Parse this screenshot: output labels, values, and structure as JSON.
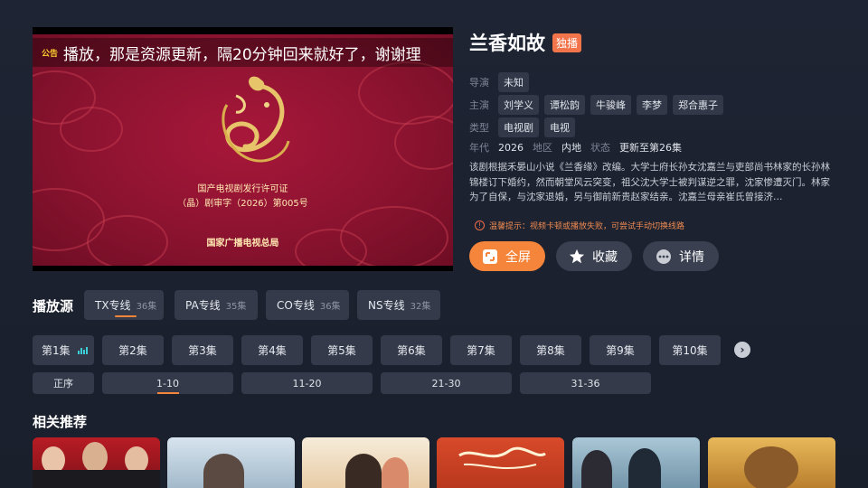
{
  "player": {
    "notice_tag": "公告",
    "notice_text": "播放，那是资源更新，隔20分钟回来就好了，谢谢理",
    "license_line1": "国产电视剧发行许可证",
    "license_line2": "（晶）剧审字（2026）第005号",
    "authority": "国家广播电视总局"
  },
  "info": {
    "title": "兰香如故",
    "badge": "独播",
    "director_label": "导演",
    "director": "未知",
    "cast_label": "主演",
    "cast": [
      "刘学义",
      "谭松韵",
      "牛骏峰",
      "李梦",
      "郑合惠子"
    ],
    "genre_label": "类型",
    "genres": [
      "电视剧",
      "电视"
    ],
    "year_label": "年代",
    "year": "2026",
    "region_label": "地区",
    "region": "内地",
    "status_label": "状态",
    "status": "更新至第26集",
    "description": "该剧根据禾晏山小说《兰香缘》改编。大学士府长孙女沈嘉兰与吏部尚书林家的长孙林锦楼订下婚约，然而朝堂风云突变，祖父沈大学士被判谋逆之罪，沈家惨遭灭门。林家为了自保，与沈家退婚，另与御前新贵赵家结亲。沈嘉兰母亲崔氏曾接济…",
    "tip": "温馨提示：视频卡顿或播放失败，可尝试手动切换线路"
  },
  "buttons": {
    "fullscreen": "全屏",
    "favorite": "收藏",
    "detail": "详情"
  },
  "sources": {
    "label": "播放源",
    "items": [
      {
        "name": "TX专线",
        "count": "36集"
      },
      {
        "name": "PA专线",
        "count": "35集"
      },
      {
        "name": "CO专线",
        "count": "36集"
      },
      {
        "name": "NS专线",
        "count": "32集"
      }
    ]
  },
  "episodes": [
    "第1集",
    "第2集",
    "第3集",
    "第4集",
    "第5集",
    "第6集",
    "第7集",
    "第8集",
    "第9集",
    "第10集"
  ],
  "ranges": {
    "order": "正序",
    "items": [
      "1-10",
      "11-20",
      "21-30",
      "31-36"
    ]
  },
  "recommend": {
    "label": "相关推荐"
  },
  "colors": {
    "accent": "#f5853b",
    "badge": "#f2744a",
    "chip_bg": "#343a4a",
    "background": "#1e2433"
  }
}
